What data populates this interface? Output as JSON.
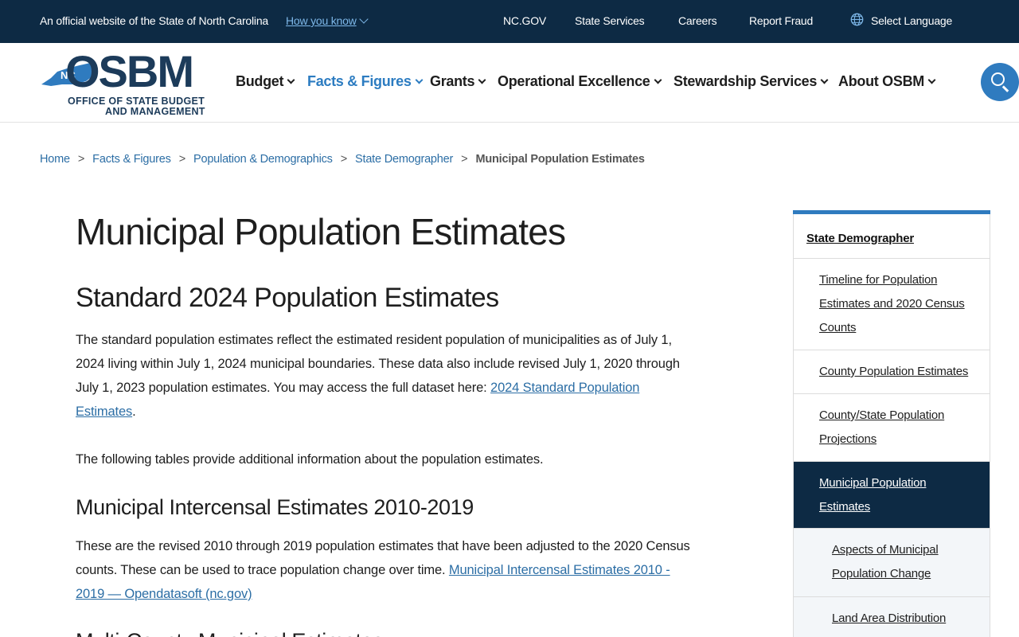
{
  "topbar": {
    "official": "An official website of the State of North Carolina",
    "how_you_know": "How you know",
    "links": [
      "NC.GOV",
      "State Services",
      "Careers",
      "Report Fraud"
    ],
    "language": "Select Language"
  },
  "logo": {
    "badge": "NC",
    "name": "OSBM",
    "line1": "OFFICE OF STATE BUDGET",
    "line2": "AND MANAGEMENT"
  },
  "nav": {
    "items": [
      {
        "label": "Budget"
      },
      {
        "label": "Facts & Figures"
      },
      {
        "label": "Grants"
      },
      {
        "label": "Operational Excellence"
      },
      {
        "label": "Stewardship Services"
      },
      {
        "label": "About OSBM"
      }
    ],
    "active": "Facts & Figures"
  },
  "breadcrumb": {
    "items": [
      "Home",
      "Facts & Figures",
      "Population & Demographics",
      "State Demographer"
    ],
    "separator": ">",
    "current": "Municipal Population Estimates"
  },
  "main": {
    "title": "Municipal Population Estimates",
    "section1": {
      "heading": "Standard 2024 Population Estimates",
      "para1_text": "The standard population estimates reflect the estimated resident population of municipalities as of July 1, 2024 living within July 1, 2024 municipal boundaries. These data also include revised July 1, 2020 through July 1, 2023 population estimates. You may access the full dataset here: ",
      "para1_link": "2024 Standard Population Estimates",
      "para1_end": ".",
      "para2": "The following tables provide additional information about the population estimates."
    },
    "section2": {
      "heading": "Municipal Intercensal Estimates 2010-2019",
      "para_text": "These are the revised 2010 through 2019 population estimates that have been adjusted to the 2020 Census counts. These can be used to trace population change over time. ",
      "para_link": "Municipal Intercensal Estimates 2010 - 2019 — Opendatasoft (nc.gov)"
    },
    "section3": {
      "heading": "Multi-County Municipal Estimates"
    }
  },
  "sidebar": {
    "heading": "State Demographer",
    "items": [
      "Timeline for Population Estimates and 2020 Census Counts",
      "County Population Estimates",
      "County/State Population Projections",
      "Municipal Population Estimates"
    ],
    "subitems": [
      "Aspects of Municipal Population Change",
      "Land Area Distribution"
    ]
  },
  "colors": {
    "topbar_bg": "#0d2a44",
    "accent": "#2f7bbf",
    "link": "#2c6ea5",
    "active_bg": "#0d2a44"
  }
}
